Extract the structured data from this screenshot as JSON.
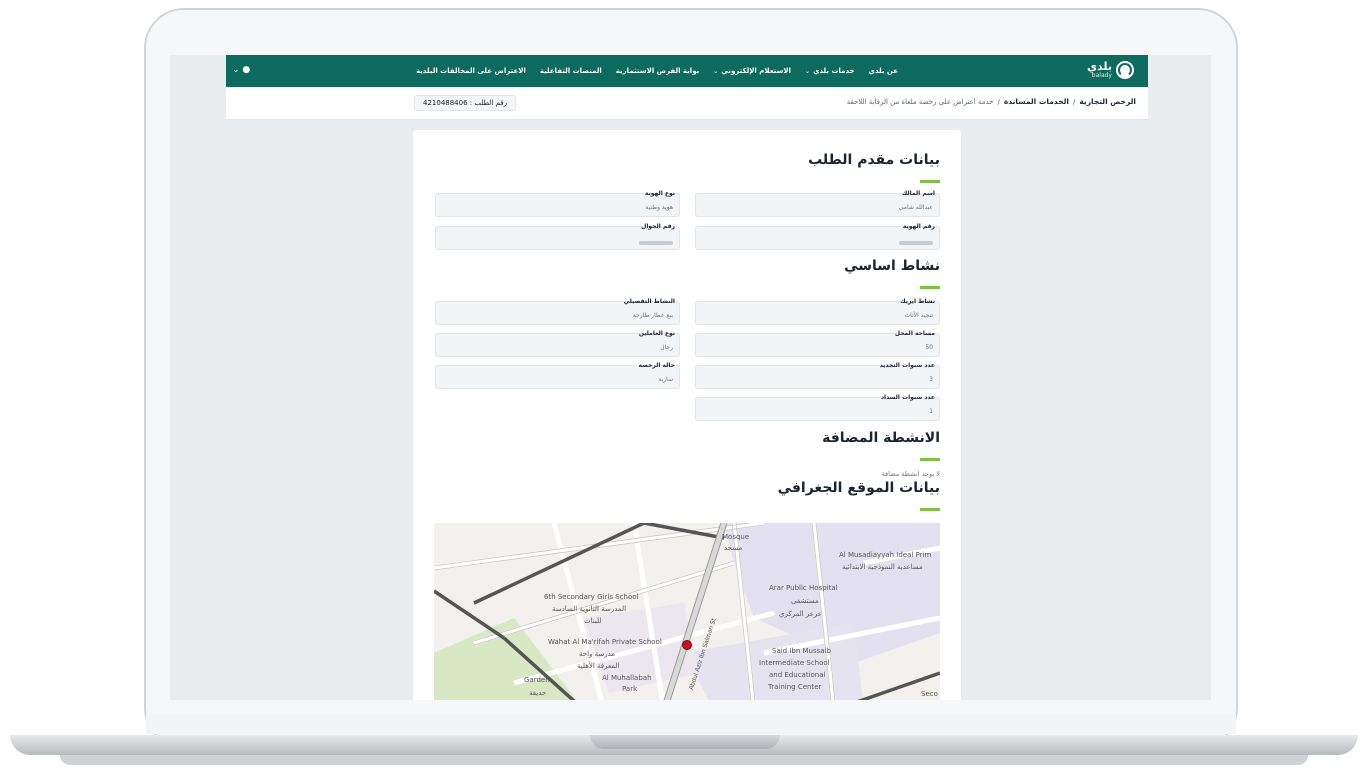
{
  "header": {
    "logo_text": "بلدي",
    "logo_sub": "balady",
    "nav": [
      {
        "label": "عن بلدي",
        "chevron": false
      },
      {
        "label": "خدمات بلدي",
        "chevron": true
      },
      {
        "label": "الاستعلام الإلكتروني",
        "chevron": true
      },
      {
        "label": "بوابة الفرص الاستثمارية",
        "chevron": false
      },
      {
        "label": "المنصات التفاعلية",
        "chevron": false
      },
      {
        "label": "الاعتراض على المخالفات البلدية",
        "chevron": false
      }
    ],
    "user_icon": "user-icon"
  },
  "breadcrumb": {
    "item1": "الرخص التجارية",
    "item2": "الخدمات المساندة",
    "item3": "خدمة اعتراض على رخصة ملغاة من الرقابة اللاحقة",
    "separator": "/"
  },
  "request_number": "رقم الطلب : 4210488406",
  "sections": {
    "applicant_title": "بيانات مقدم الطلب",
    "activity_title": "نشاط اساسي",
    "added_title": "الانشطة المضافة",
    "added_note": "لا يوجد انشطة مضافة",
    "location_title": "بيانات الموقع الجغرافي"
  },
  "applicant": {
    "owner_name_label": "اسم المالك",
    "owner_name_value": "عبدالله شامي",
    "id_type_label": "نوع الهوية",
    "id_type_value": "هوية وطنية",
    "id_number_label": "رقم الهوية",
    "mobile_label": "رقم الجوال"
  },
  "activity": {
    "isic_label": "نشاط ايزيك",
    "isic_value": "تنجيد الأثاث",
    "detailed_label": "النشاط التفصيلي",
    "detailed_value": "بيع عطار طازجة",
    "area_label": "مساحة المحل",
    "area_value": "50",
    "workers_label": "نوع العاملين",
    "workers_value": "رجال",
    "renewal_label": "عدد سنوات التجديد",
    "renewal_value": "3",
    "license_status_label": "حالة الرخصة",
    "license_status_value": "سارية",
    "payment_label": "عدد سنوات السداد",
    "payment_value": "1"
  },
  "map": {
    "labels": [
      "Mosque",
      "مسجد",
      "Al Musadiayyah Ideal Prim",
      "مساعدية النموذجية الابتدائية",
      "6th Secondary Girls School",
      "المدرسة الثانوية السادسة",
      "للبنات",
      "Arar Public Hospital",
      "مستشفى",
      "عرعر المركزي",
      "Wahat Al Ma'rifah Private School",
      "مدرسة واحة",
      "المعرفة الأهلية",
      "Al Muhallabah",
      "Park",
      "Garden",
      "حديقة",
      "Said Ibn Mussaib",
      "Intermediate School",
      "and Educational",
      "Training Center",
      "Seco",
      "Abdul Aziz Ibn Salman St"
    ]
  },
  "colors": {
    "brand": "#0c6b5e",
    "accent": "#7dc242",
    "pin": "#c1121f"
  }
}
